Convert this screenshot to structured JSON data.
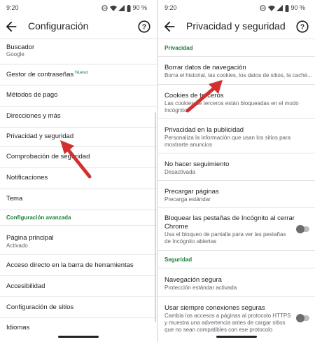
{
  "status": {
    "time": "9:20",
    "battery": "90 %"
  },
  "left": {
    "title": "Configuración",
    "items": [
      {
        "title": "Buscador",
        "subtitle": "Google"
      },
      {
        "title": "Gestor de contraseñas",
        "badge": "Nuevo"
      },
      {
        "title": "Métodos de pago"
      },
      {
        "title": "Direcciones y más"
      },
      {
        "title": "Privacidad y seguridad"
      },
      {
        "title": "Comprobación de seguridad"
      },
      {
        "title": "Notificaciones"
      },
      {
        "title": "Tema"
      }
    ],
    "section_advanced": "Configuración avanzada",
    "advanced_items": [
      {
        "title": "Página principal",
        "subtitle": "Activado"
      },
      {
        "title": "Acceso directo en la barra de herramientas"
      },
      {
        "title": "Accesibilidad"
      },
      {
        "title": "Configuración de sitios"
      },
      {
        "title": "Idiomas"
      }
    ]
  },
  "right": {
    "title": "Privacidad y seguridad",
    "section_privacy": "Privacidad",
    "items": [
      {
        "title": "Borrar datos de navegación",
        "subtitle": "Borra el historial, las cookies, los datos de sitios, la caché..."
      },
      {
        "title": "Cookies de terceros",
        "subtitle": "Las cookies de terceros están bloqueadas en el modo Incógnito"
      },
      {
        "title": "Privacidad en la publicidad",
        "subtitle": "Personaliza la información que usan los sitios para mostrarte anuncios"
      },
      {
        "title": "No hacer seguimiento",
        "subtitle": "Desactivada"
      },
      {
        "title": "Precargar páginas",
        "subtitle": "Precarga estándar"
      },
      {
        "title": "Bloquear las pestañas de Incógnito al cerrar Chrome",
        "subtitle": "Usa el bloqueo de pantalla para ver las pestañas de Incógnito abiertas",
        "toggle": false
      }
    ],
    "section_security": "Seguridad",
    "security_items": [
      {
        "title": "Navegación segura",
        "subtitle": "Protección estándar activada"
      },
      {
        "title": "Usar siempre conexiones seguras",
        "subtitle": "Cambia los accesos a páginas al protocolo HTTPS y muestra una advertencia antes de cargar sitios que no sean compatibles con ese protocolo",
        "toggle": false
      }
    ]
  },
  "colors": {
    "accent_green": "#188038",
    "arrow_red": "#d32f2f"
  }
}
